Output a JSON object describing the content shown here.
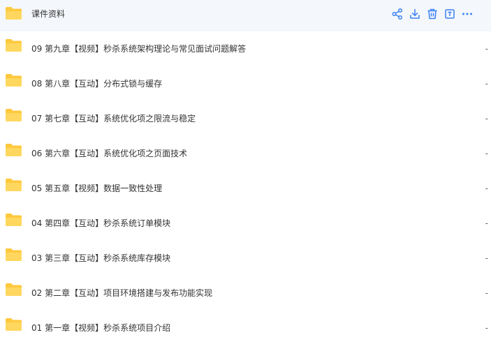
{
  "accent_color": "#3b82f6",
  "folder_color": "#ffc93e",
  "rows": [
    {
      "label": "课件资料",
      "selected": true,
      "actions": [
        "share-icon",
        "download-icon",
        "delete-icon",
        "rename-icon",
        "more-icon"
      ]
    },
    {
      "label": "09 第九章【视频】秒杀系统架构理论与常见面试问题解答",
      "size": "-"
    },
    {
      "label": "08 第八章【互动】分布式锁与缓存",
      "size": "-"
    },
    {
      "label": "07 第七章【互动】系统优化项之限流与稳定",
      "size": "-"
    },
    {
      "label": "06 第六章【互动】系统优化项之页面技术",
      "size": "-"
    },
    {
      "label": "05 第五章【视频】数据一致性处理",
      "size": "-"
    },
    {
      "label": "04 第四章【互动】秒杀系统订单模块",
      "size": "-"
    },
    {
      "label": "03 第三章【互动】秒杀系统库存模块",
      "size": "-"
    },
    {
      "label": "02 第二章【互动】项目环境搭建与发布功能实现",
      "size": "-"
    },
    {
      "label": "01 第一章【视频】秒杀系统项目介绍",
      "size": "-"
    }
  ]
}
